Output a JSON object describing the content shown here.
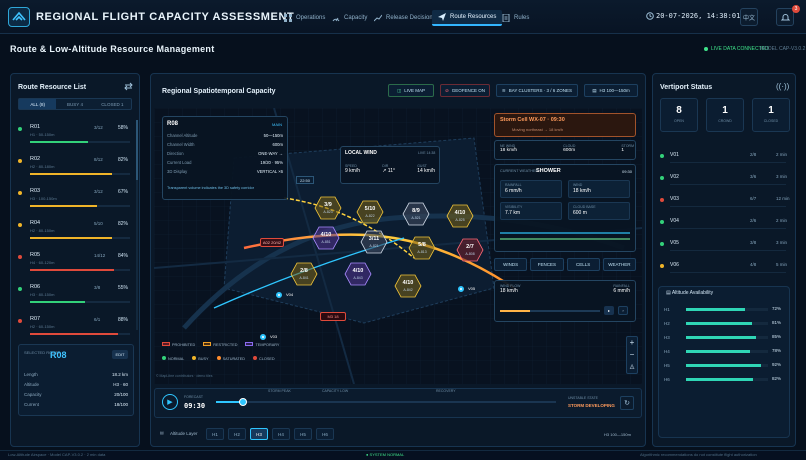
{
  "app": {
    "title": "REGIONAL FLIGHT CAPACITY ASSESSMENT",
    "nav": [
      {
        "label": "Operations",
        "icon": "grid-icon"
      },
      {
        "label": "Capacity",
        "icon": "gauge-icon"
      },
      {
        "label": "Release Decision",
        "icon": "chart-icon"
      },
      {
        "label": "Route Resources",
        "icon": "plane-icon",
        "active": true
      },
      {
        "label": "Rules",
        "icon": "rules-icon"
      }
    ],
    "clock": "20-07-2026, 14:38:01",
    "lang_label": "中文",
    "notification_count": "3"
  },
  "page": {
    "title": "Route & Low-Altitude Resource Management",
    "live_label": "LIVE DATA CONNECTED",
    "model_label": "MODEL CAP-V3.0.2"
  },
  "left": {
    "title": "Route Resource List",
    "tabs": [
      "ALL (8)",
      "BUSY 4",
      "CLOSED 1"
    ],
    "routes": [
      {
        "name": "R01",
        "sub": "H1 · 50-150m",
        "ratio": "3/12",
        "pct": "58%",
        "fill": 0.58,
        "color": "#33d17a"
      },
      {
        "name": "R02",
        "sub": "H2 · 80-180m",
        "ratio": "8/12",
        "pct": "82%",
        "fill": 0.82,
        "color": "#f0b429"
      },
      {
        "name": "R03",
        "sub": "H3 · 100-150m",
        "ratio": "3/12",
        "pct": "67%",
        "fill": 0.67,
        "color": "#f0b429"
      },
      {
        "name": "R04",
        "sub": "H2 · 80-150m",
        "ratio": "5/10",
        "pct": "82%",
        "fill": 0.82,
        "color": "#f0b429"
      },
      {
        "name": "R05",
        "sub": "H4 · 60-120m",
        "ratio": "14/12",
        "pct": "84%",
        "fill": 0.84,
        "color": "#e04a3b"
      },
      {
        "name": "R06",
        "sub": "H3 · 80-150m",
        "ratio": "3/8",
        "pct": "55%",
        "fill": 0.55,
        "color": "#33d17a"
      },
      {
        "name": "R07",
        "sub": "H2 · 60-150m",
        "ratio": "6/1",
        "pct": "88%",
        "fill": 0.88,
        "color": "#e04a3b"
      }
    ],
    "selected": {
      "label": "SELECTED ROUTE",
      "id": "R08",
      "button": "EDIT",
      "fields": [
        {
          "k": "Length",
          "v": "18.2 km"
        },
        {
          "k": "Altitude",
          "v": "H3 · 60"
        },
        {
          "k": "Capacity",
          "v": "20/100"
        },
        {
          "k": "Current",
          "v": "18/100"
        }
      ]
    }
  },
  "map": {
    "title": "Regional Spatiotemporal Capacity",
    "chips": [
      "LIVE MAP",
      "GEOFENCE ON",
      "BAY CLUSTERS · 3 / 6 ZONES",
      "H3 100—150m"
    ],
    "route_card": {
      "title": "R08",
      "tag": "MAIN",
      "rows": [
        {
          "k": "Channel Altitude",
          "v": "50—150m"
        },
        {
          "k": "Channel Width",
          "v": "600m"
        },
        {
          "k": "Direction",
          "v": "ONE-WAY →"
        },
        {
          "k": "Current Load",
          "v": "19/20 · 95%"
        },
        {
          "k": "3D Display",
          "v": "VERTICAL ×6"
        }
      ],
      "note": "Transparent volume indicates the 3D safety corridor"
    },
    "wind_card": {
      "title": "LOCAL WIND",
      "tag": "LIVE 14:38",
      "items": [
        {
          "k": "SPEED",
          "v": "9 km/h"
        },
        {
          "k": "DIR",
          "v": "↗ 11°"
        },
        {
          "k": "GUST",
          "v": "14 km/h"
        }
      ]
    },
    "cells": [
      {
        "label": "3/9",
        "sub": "A-823",
        "color": "yellow"
      },
      {
        "label": "5/10",
        "sub": "A-822",
        "color": "yellow"
      },
      {
        "label": "8/9",
        "sub": "A-521",
        "color": "white"
      },
      {
        "label": "4/10",
        "sub": "A-825",
        "color": "yellow"
      },
      {
        "label": "4/10",
        "sub": "A-851",
        "color": "purple"
      },
      {
        "label": "3/11",
        "sub": "A-821",
        "color": "white"
      },
      {
        "label": "5/8",
        "sub": "A-813",
        "color": "yellow"
      },
      {
        "label": "2/7",
        "sub": "A-808",
        "color": "red"
      },
      {
        "label": "2/8",
        "sub": "A-841",
        "color": "yellow"
      },
      {
        "label": "4/10",
        "sub": "A-843",
        "color": "purple"
      },
      {
        "label": "4/10",
        "sub": "A-842",
        "color": "yellow"
      }
    ],
    "markers": [
      {
        "label": "A02",
        "value": "20/42"
      },
      {
        "label": "V04",
        "value": ""
      },
      {
        "label": "V05",
        "value": ""
      },
      {
        "label": "V03",
        "value": ""
      },
      {
        "label": "M3 18",
        "value": ""
      },
      {
        "label": "22:50",
        "value": ""
      }
    ],
    "legend_zones": [
      "PROHIBITED",
      "RESTRICTED",
      "TEMPORARY"
    ],
    "legend_status": [
      "NORMAL",
      "BUSY",
      "SATURATED",
      "CLOSED"
    ],
    "attribution": "© MapLibre contributors · demo tiles"
  },
  "weather": {
    "storm": {
      "title": "Storm Cell WX-07 · 09:30",
      "sub": "Moving northeast → 18 km/h"
    },
    "metrics": [
      {
        "k": "NE WIND",
        "v": "18 km/h"
      },
      {
        "k": "CLOUD",
        "v": "600m"
      },
      {
        "k": "STORM",
        "v": "1"
      }
    ],
    "current_label": "CURRENT WEATHER",
    "current_value": "SHOWER",
    "current_time": "09:30",
    "details": [
      {
        "k": "RAINFALL",
        "v": "6 mm/h"
      },
      {
        "k": "WIND",
        "v": "18 km/h"
      },
      {
        "k": "VISIBILITY",
        "v": "7.7 km"
      },
      {
        "k": "CLOUD BASE",
        "v": "600 m"
      }
    ],
    "filters": [
      "WINDS",
      "FENCES",
      "CELLS",
      "WEATHER"
    ],
    "flow": [
      {
        "k": "WIND FLOW",
        "v": "18 km/h"
      },
      {
        "k": "RAINFALL",
        "v": "6 mm/h"
      }
    ],
    "timeline_ticks": [
      "0",
      "30",
      "60"
    ]
  },
  "timeline": {
    "time": "09:30",
    "label": "FORECAST",
    "events": [
      "STORM PEAK",
      "CAPACITY LOW",
      "RECOVERY"
    ],
    "status_label": "UNSTABLE STATE",
    "status_value": "STORM DEVELOPING",
    "progress": 0.08
  },
  "altitude_layer": {
    "label": "Altitude Layer",
    "layers": [
      "H1",
      "H2",
      "H3",
      "H4",
      "H5",
      "H6"
    ],
    "active": "H3",
    "range": "H3 100—150m"
  },
  "right": {
    "title": "Vertiport Status",
    "stats": [
      {
        "v": "8",
        "l": "OPEN"
      },
      {
        "v": "1",
        "l": "CROWD"
      },
      {
        "v": "1",
        "l": "CLOSED"
      }
    ],
    "vertiports": [
      {
        "name": "V01",
        "ratio": "2/8",
        "wait": "2 min",
        "color": "#33d17a"
      },
      {
        "name": "V02",
        "ratio": "3/6",
        "wait": "3 min",
        "color": "#33d17a"
      },
      {
        "name": "V03",
        "ratio": "6/7",
        "wait": "12 min",
        "color": "#e04a3b"
      },
      {
        "name": "V04",
        "ratio": "2/6",
        "wait": "2 min",
        "color": "#33d17a"
      },
      {
        "name": "V05",
        "ratio": "3/8",
        "wait": "3 min",
        "color": "#33d17a"
      },
      {
        "name": "V06",
        "ratio": "4/8",
        "wait": "5 min",
        "color": "#f0b429"
      }
    ],
    "altitude_title": "Altitude Availability",
    "altitude": [
      {
        "n": "H1",
        "p": "72%",
        "f": 0.72
      },
      {
        "n": "H2",
        "p": "81%",
        "f": 0.81
      },
      {
        "n": "H3",
        "p": "85%",
        "f": 0.85
      },
      {
        "n": "H4",
        "p": "78%",
        "f": 0.78
      },
      {
        "n": "H5",
        "p": "92%",
        "f": 0.92
      },
      {
        "n": "H6",
        "p": "82%",
        "f": 0.82
      }
    ]
  },
  "footer": {
    "left": "Low-Altitude Airspace · Model CAP-V3.0.2 · 2 min data",
    "center": "SYSTEM NORMAL",
    "right": "Algorithmic recommendations do not constitute flight authorization"
  }
}
